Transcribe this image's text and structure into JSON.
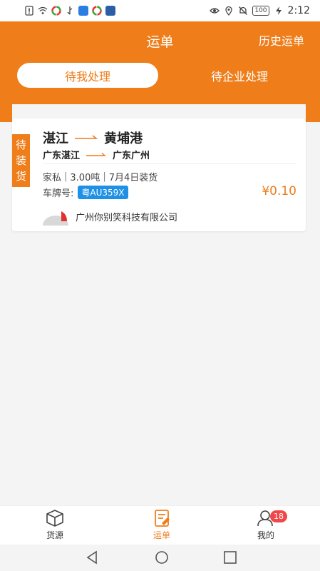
{
  "status_bar": {
    "battery": "100",
    "time": "2:12"
  },
  "header": {
    "title": "运单",
    "history_link": "历史运单"
  },
  "tabs": [
    {
      "label": "待我处理",
      "active": true
    },
    {
      "label": "待企业处理",
      "active": false
    }
  ],
  "order": {
    "status_tag": [
      "待",
      "装",
      "货"
    ],
    "origin": "湛江",
    "destination": "黄埔港",
    "origin_region": "广东湛江",
    "destination_region": "广东广州",
    "cargo": "家私",
    "weight": "3.00吨",
    "load_date": "7月4日装货",
    "plate_label": "车牌号:",
    "plate": "粤AU359X",
    "price": "¥0.10",
    "company": "广州你别笑科技有限公司"
  },
  "bottom_nav": [
    {
      "label": "货源",
      "icon": "box-icon"
    },
    {
      "label": "运单",
      "icon": "waybill-icon",
      "active": true
    },
    {
      "label": "我的",
      "icon": "profile-icon",
      "badge": "18"
    }
  ],
  "colors": {
    "accent": "#ee7d1a",
    "plate_blue": "#1e90e6",
    "badge_red": "#f04848"
  }
}
